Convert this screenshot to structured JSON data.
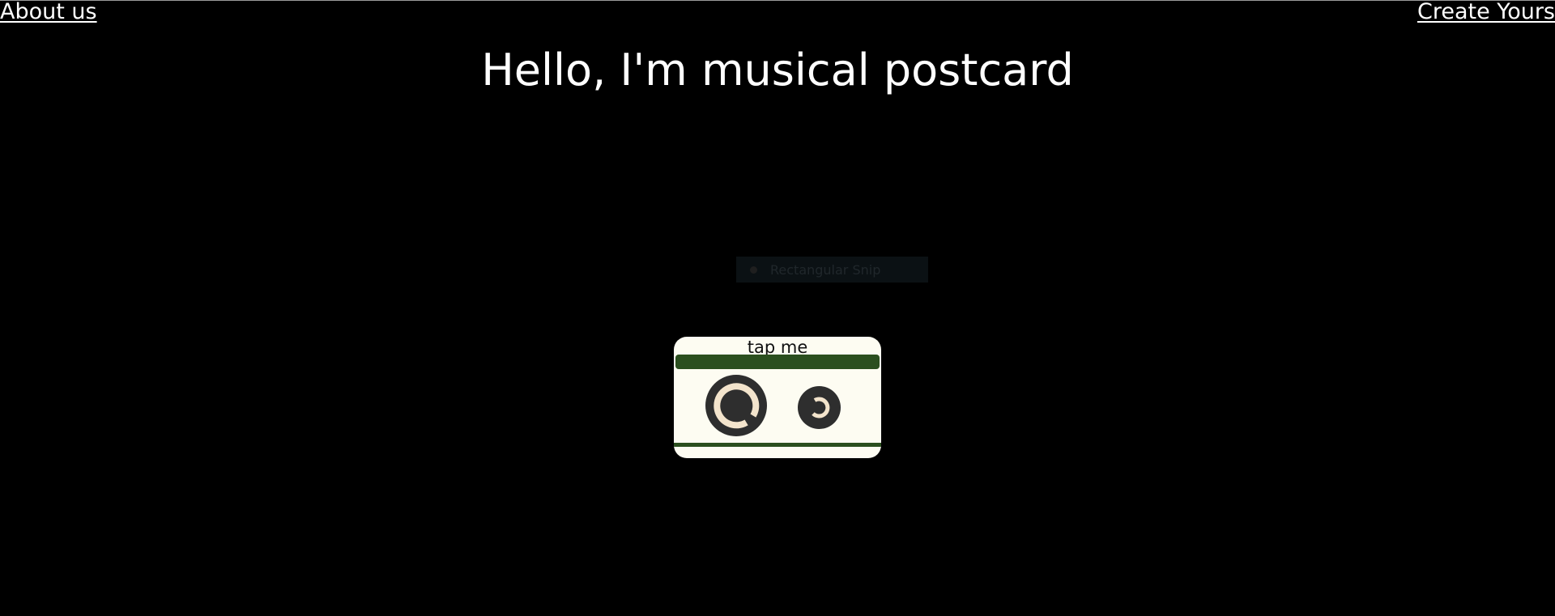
{
  "nav": {
    "about_label": "About us",
    "create_label": "Create Yours"
  },
  "page": {
    "title": "Hello, I'm musical postcard"
  },
  "snip_overlay": {
    "label": "Rectangular Snip",
    "icon": "record-dot-icon"
  },
  "cassette": {
    "label": "tap me",
    "icons": [
      "large-reel-icon",
      "small-reel-icon"
    ],
    "colors": {
      "body": "#fdfcf2",
      "tape": "#2b4f1f",
      "reel": "#2e2e2e",
      "hub": "#f3e4cc"
    }
  }
}
